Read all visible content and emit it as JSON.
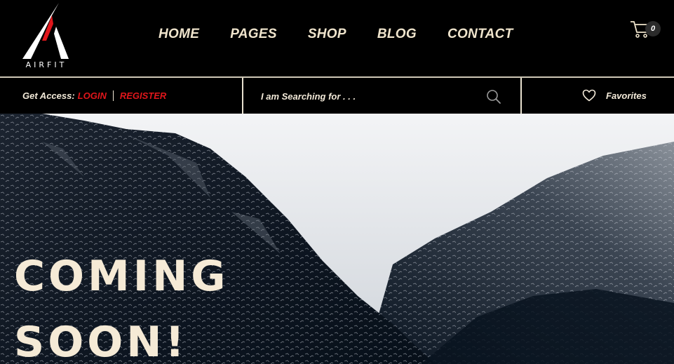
{
  "brand": {
    "name": "AIRFIT",
    "accent": "#e0161b"
  },
  "nav": {
    "items": [
      {
        "label": "HOME"
      },
      {
        "label": "PAGES"
      },
      {
        "label": "SHOP"
      },
      {
        "label": "BLOG"
      },
      {
        "label": "CONTACT"
      }
    ]
  },
  "cart": {
    "icon": "cart-icon",
    "count": "0"
  },
  "access": {
    "label": "Get Access:",
    "login": "LOGIN",
    "register": "REGISTER"
  },
  "search": {
    "placeholder": "I am Searching for . . .",
    "icon": "search-icon"
  },
  "favorites": {
    "label": "Favorites",
    "icon": "heart-icon"
  },
  "hero": {
    "line1": "COMING",
    "line2": "SOON!"
  }
}
